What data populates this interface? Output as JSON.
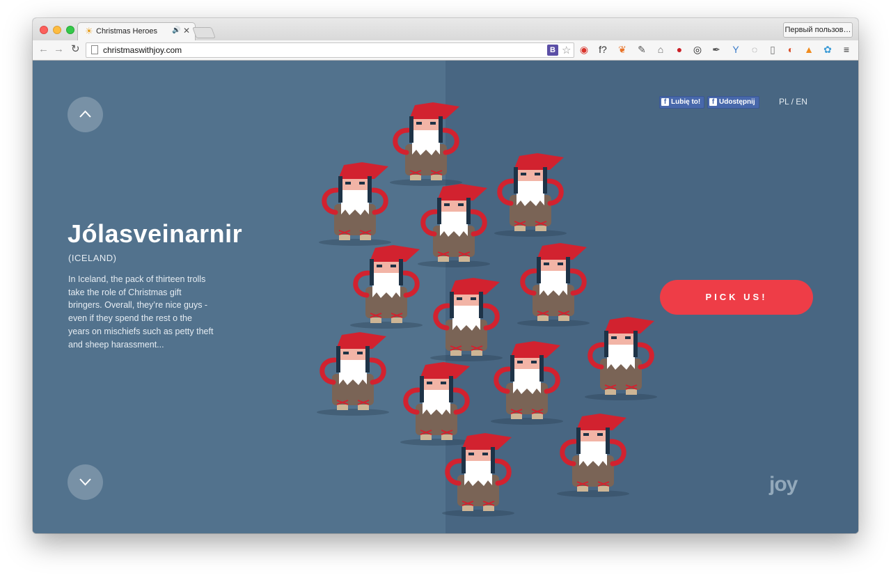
{
  "browser": {
    "tab_title": "Christmas Heroes",
    "tab_favicon": "☀",
    "tab_audio_icon": "🔊",
    "tab_close": "✕",
    "profile_label": "Первый пользов…",
    "url": "christmaswithjoy.com",
    "nav": {
      "back": "←",
      "forward": "→",
      "reload": "↻"
    },
    "bookmark_star": "☆",
    "b_extension": "B",
    "extensions": [
      {
        "icon": "opera-icon",
        "glyph": "◉",
        "color": "#d9342b"
      },
      {
        "icon": "font-icon",
        "glyph": "f?",
        "color": "#333333"
      },
      {
        "icon": "fox-icon",
        "glyph": "❦",
        "color": "#e8742a"
      },
      {
        "icon": "evernote-icon",
        "glyph": "✎",
        "color": "#555555"
      },
      {
        "icon": "pocket-icon",
        "glyph": "⌂",
        "color": "#666666"
      },
      {
        "icon": "pinterest-icon",
        "glyph": "●",
        "color": "#cb2027"
      },
      {
        "icon": "lens-icon",
        "glyph": "◎",
        "color": "#222222"
      },
      {
        "icon": "eyedropper-icon",
        "glyph": "✒",
        "color": "#555555"
      },
      {
        "icon": "y-icon",
        "glyph": "Y",
        "color": "#3a7bc8"
      },
      {
        "icon": "spinner-icon",
        "glyph": "◌",
        "color": "#777777"
      },
      {
        "icon": "reader-icon",
        "glyph": "▯",
        "color": "#777777"
      },
      {
        "icon": "timer-icon",
        "glyph": "◐",
        "color": "#d94f2b"
      },
      {
        "icon": "chart-icon",
        "glyph": "▲",
        "color": "#f08b1d"
      },
      {
        "icon": "flower-icon",
        "glyph": "✿",
        "color": "#3c9bd6"
      },
      {
        "icon": "menu-icon",
        "glyph": "≡",
        "color": "#333333"
      }
    ]
  },
  "hero": {
    "title": "Jólasveinarnir",
    "subtitle": "(ICELAND)",
    "description": "In Iceland, the pack of thirteen trolls take the role of Christmas gift bringers. Overall, they’re nice guys - even if they spend the rest o the years on mischiefs such as petty theft and sheep harassment..."
  },
  "social": {
    "like": "Lubię to!",
    "share": "Udostępnij",
    "fb_glyph": "f"
  },
  "lang": {
    "pl": "PL",
    "sep": " / ",
    "en": "EN"
  },
  "cta": {
    "label": "PICK US!"
  },
  "logo": {
    "text": "joy"
  },
  "colors": {
    "accent": "#ee3d47",
    "bg_left": "#52728d",
    "bg_right": "#486682",
    "hat": "#d2222f",
    "coat": "#7a6456"
  }
}
